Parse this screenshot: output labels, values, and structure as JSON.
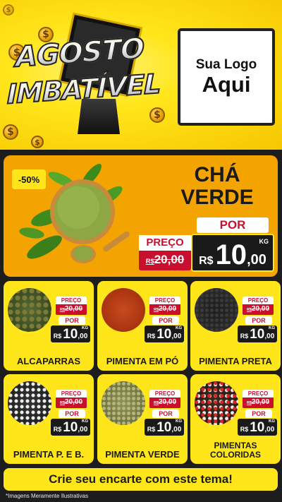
{
  "header": {
    "title_line1": "AGOSTO",
    "title_line2": "IMBATÍVEL",
    "coin_symbol": "$",
    "logo_line1": "Sua Logo",
    "logo_line2": "Aqui"
  },
  "featured": {
    "discount_badge": "-50%",
    "name_line1": "CHÁ",
    "name_line2": "VERDE",
    "por_label": "POR",
    "preco_label": "PREÇO",
    "old_currency": "R$",
    "old_value": "20,00",
    "currency": "R$",
    "price_int": "10",
    "price_dec": ",00",
    "unit": "KG"
  },
  "products": [
    {
      "name": "ALCAPARRAS",
      "preco_label": "PREÇO",
      "old_currency": "R$",
      "old_value": "20,00",
      "por_label": "POR",
      "currency": "R$",
      "price_int": "10",
      "price_dec": ",00",
      "unit": "KG"
    },
    {
      "name": "PIMENTA EM PÓ",
      "preco_label": "PREÇO",
      "old_currency": "R$",
      "old_value": "20,00",
      "por_label": "POR",
      "currency": "R$",
      "price_int": "10",
      "price_dec": ",00",
      "unit": "KG"
    },
    {
      "name": "PIMENTA PRETA",
      "preco_label": "PREÇO",
      "old_currency": "R$",
      "old_value": "20,00",
      "por_label": "POR",
      "currency": "R$",
      "price_int": "10",
      "price_dec": ",00",
      "unit": "KG"
    },
    {
      "name": "PIMENTA P. E B.",
      "preco_label": "PREÇO",
      "old_currency": "R$",
      "old_value": "20,00",
      "por_label": "POR",
      "currency": "R$",
      "price_int": "10",
      "price_dec": ",00",
      "unit": "KG"
    },
    {
      "name": "PIMENTA VERDE",
      "preco_label": "PREÇO",
      "old_currency": "R$",
      "old_value": "20,00",
      "por_label": "POR",
      "currency": "R$",
      "price_int": "10",
      "price_dec": ",00",
      "unit": "KG"
    },
    {
      "name": "PIMENTAS COLORIDAS",
      "preco_label": "PREÇO",
      "old_currency": "R$",
      "old_value": "20,00",
      "por_label": "POR",
      "currency": "R$",
      "price_int": "10",
      "price_dec": ",00",
      "unit": "KG"
    }
  ],
  "footer": {
    "cta": "Crie seu encarte com este tema!",
    "disclaimer": "*Imagens Meramente Ilustrativas"
  },
  "colors": {
    "brand_yellow": "#ffe61a",
    "feature_orange": "#f4a400",
    "price_red": "#c8102e",
    "dark": "#1d1d1d"
  },
  "icons": [
    "dollar-coin-icon",
    "green-tea-leaf-icon",
    "wooden-spoon-icon"
  ]
}
